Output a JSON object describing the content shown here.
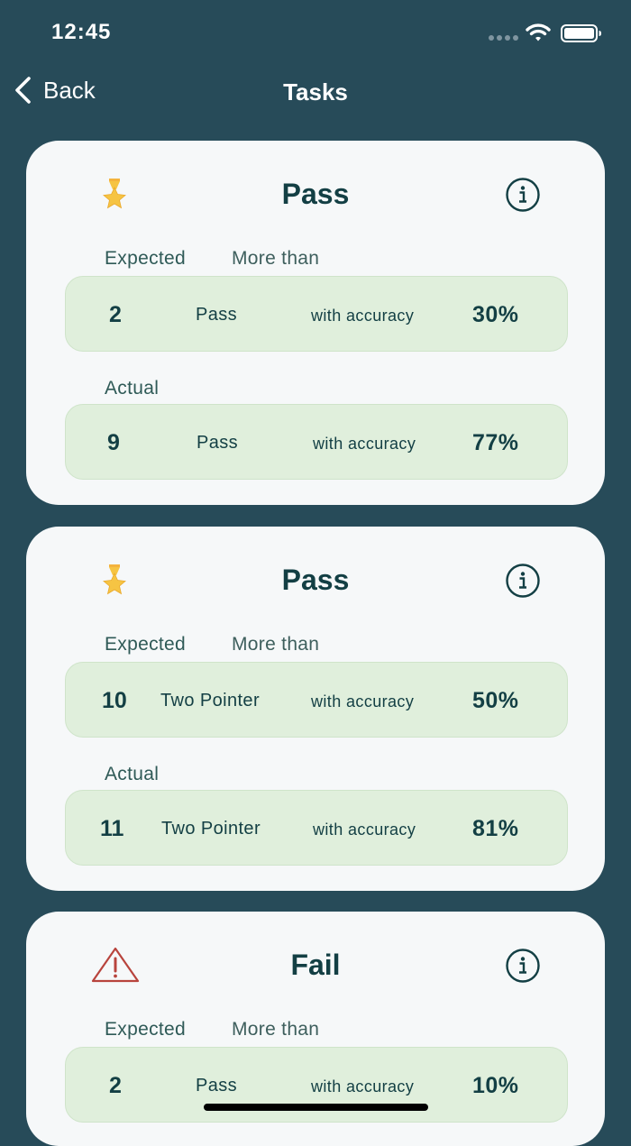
{
  "status_bar": {
    "time": "12:45"
  },
  "nav": {
    "back_label": "Back",
    "title": "Tasks"
  },
  "colors": {
    "background": "#274b59",
    "card": "#f6f8f9",
    "row_fill": "#e0efdc",
    "text_dark": "#133f44",
    "medal_gold": "#f6c443",
    "fail_red": "#c0392b"
  },
  "cards": [
    {
      "status": "Pass",
      "icon": "medal-star-icon",
      "expected_label": "Expected",
      "condition_label": "More than",
      "expected": {
        "count": "2",
        "task": "Pass",
        "accuracy_label": "with accuracy",
        "accuracy": "30%"
      },
      "actual_label": "Actual",
      "actual": {
        "count": "9",
        "task": "Pass",
        "accuracy_label": "with accuracy",
        "accuracy": "77%"
      }
    },
    {
      "status": "Pass",
      "icon": "medal-star-icon",
      "expected_label": "Expected",
      "condition_label": "More than",
      "expected": {
        "count": "10",
        "task": "Two Pointer",
        "accuracy_label": "with accuracy",
        "accuracy": "50%"
      },
      "actual_label": "Actual",
      "actual": {
        "count": "11",
        "task": "Two Pointer",
        "accuracy_label": "with accuracy",
        "accuracy": "81%"
      }
    },
    {
      "status": "Fail",
      "icon": "warning-triangle-icon",
      "expected_label": "Expected",
      "condition_label": "More than",
      "expected": {
        "count": "2",
        "task": "Pass",
        "accuracy_label": "with accuracy",
        "accuracy": "10%"
      }
    }
  ]
}
